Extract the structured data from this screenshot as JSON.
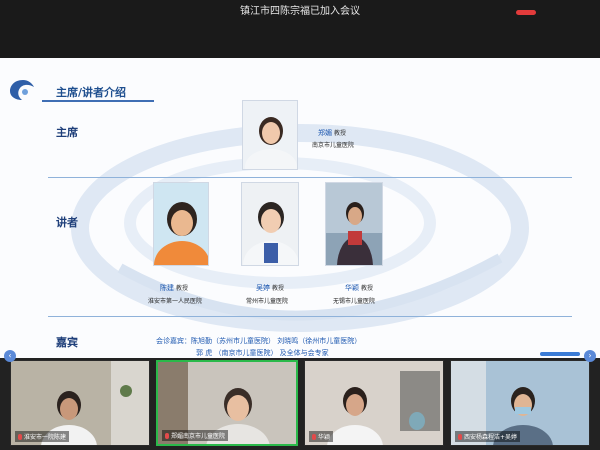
{
  "meeting": {
    "join_notice": "镇江市四陈宗福已加入会议"
  },
  "slide": {
    "section_title": "主席/讲者介绍",
    "rows": {
      "chair_label": "主席",
      "speaker_label": "讲者",
      "guest_label": "嘉宾"
    },
    "chair": {
      "name": "郑媚",
      "title": "教授",
      "institution": "南京市儿童医院"
    },
    "speakers": [
      {
        "name": "陈建",
        "title": "教授",
        "institution": "淮安市第一人民医院"
      },
      {
        "name": "吴婷",
        "title": "教授",
        "institution": "常州市儿童医院"
      },
      {
        "name": "华颖",
        "title": "教授",
        "institution": "无锡市儿童医院"
      }
    ],
    "guests": {
      "line1": "会诊嘉宾：陈旭勤（苏州市儿童医院）    刘晓鸣（徐州市儿童医院）",
      "line2": "郭  虎 （南京市儿童医院）    及全体与会专家"
    }
  },
  "video_tiles": [
    {
      "label": "淮安市一院陈建"
    },
    {
      "label": "郑媚南京市儿童医院"
    },
    {
      "label": "华颖"
    },
    {
      "label": "西安杨森程洁+吴婷"
    }
  ],
  "colors": {
    "accent": "#1f4f8f",
    "name_blue": "#1e58b0",
    "active_speaker": "#2ab94a",
    "recording": "#e23b3b"
  }
}
